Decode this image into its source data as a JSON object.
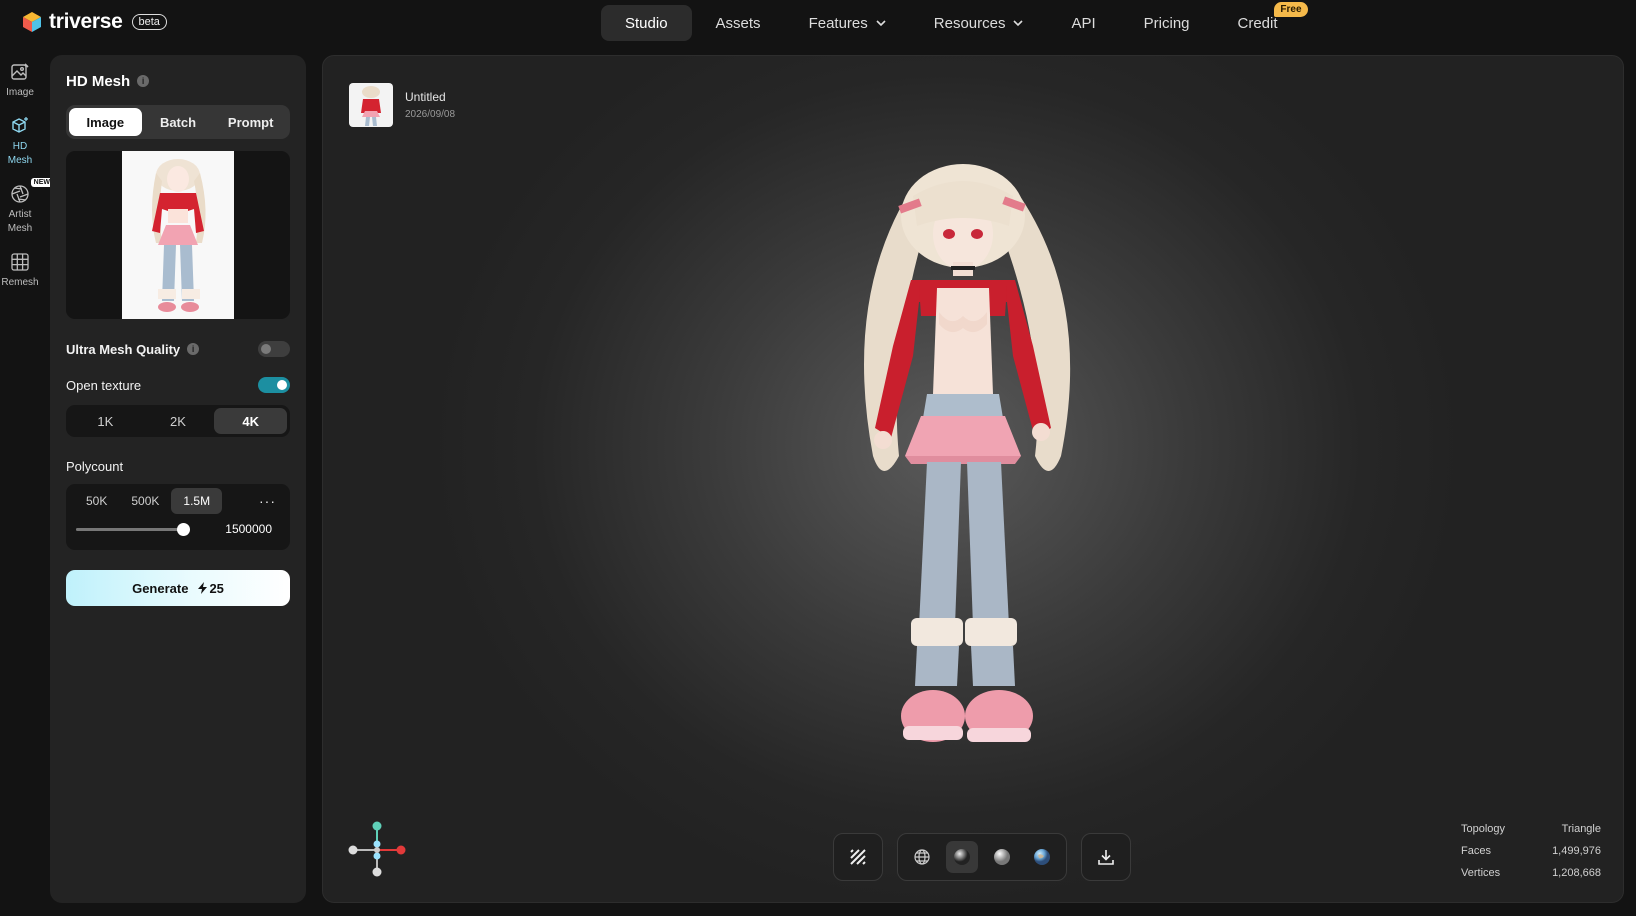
{
  "brand": {
    "name": "triverse",
    "badge": "beta"
  },
  "nav": {
    "items": [
      {
        "label": "Studio",
        "active": true,
        "dropdown": false
      },
      {
        "label": "Assets",
        "active": false,
        "dropdown": false
      },
      {
        "label": "Features",
        "active": false,
        "dropdown": true
      },
      {
        "label": "Resources",
        "active": false,
        "dropdown": true
      },
      {
        "label": "API",
        "active": false,
        "dropdown": false
      },
      {
        "label": "Pricing",
        "active": false,
        "dropdown": false
      },
      {
        "label": "Credit",
        "active": false,
        "dropdown": false,
        "badge": "Free"
      }
    ]
  },
  "rail": {
    "items": [
      {
        "label": "Image",
        "icon": "image-edit-icon",
        "active": false
      },
      {
        "label": "HD\nMesh",
        "icon": "cube-sparkle-icon",
        "active": true
      },
      {
        "label": "Artist\nMesh",
        "icon": "aperture-icon",
        "active": false,
        "badge": "NEW"
      },
      {
        "label": "Remesh",
        "icon": "grid-icon",
        "active": false
      }
    ]
  },
  "panel": {
    "title": "HD Mesh",
    "info_icon": "i",
    "input_tabs": [
      "Image",
      "Batch",
      "Prompt"
    ],
    "input_tab_active": "Image",
    "ultra_mesh_quality": {
      "label": "Ultra Mesh Quality",
      "on": false
    },
    "open_texture": {
      "label": "Open texture",
      "on": true
    },
    "texture_res": [
      "1K",
      "2K",
      "4K"
    ],
    "texture_res_active": "4K",
    "polycount": {
      "label": "Polycount",
      "options": [
        "50K",
        "500K",
        "1.5M"
      ],
      "active": "1.5M",
      "more": "···",
      "value": "1500000",
      "slider_fraction": 1.0
    },
    "generate": {
      "label": "Generate",
      "cost": "25"
    }
  },
  "viewer": {
    "asset": {
      "name": "Untitled",
      "date": "2026/09/08"
    },
    "toolbar": {
      "wireframe_icon": "stripes-icon",
      "render_modes": [
        "globe-wire-icon",
        "shaded-sphere-icon",
        "clay-sphere-icon",
        "textured-sphere-icon"
      ],
      "render_mode_active": 1,
      "download_icon": "download-icon"
    },
    "stats": [
      {
        "label": "Topology",
        "value": "Triangle"
      },
      {
        "label": "Faces",
        "value": "1,499,976"
      },
      {
        "label": "Vertices",
        "value": "1,208,668"
      }
    ]
  },
  "colors": {
    "accent": "#1c8fa1",
    "generate_start": "#bff1fb",
    "free_badge": "#f5b94a"
  }
}
